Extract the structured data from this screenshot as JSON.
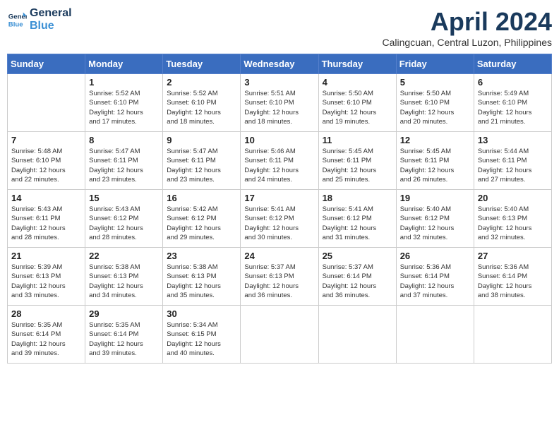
{
  "header": {
    "logo_line1": "General",
    "logo_line2": "Blue",
    "month": "April 2024",
    "location": "Calingcuan, Central Luzon, Philippines"
  },
  "weekdays": [
    "Sunday",
    "Monday",
    "Tuesday",
    "Wednesday",
    "Thursday",
    "Friday",
    "Saturday"
  ],
  "weeks": [
    [
      {
        "day": "",
        "info": ""
      },
      {
        "day": "1",
        "info": "Sunrise: 5:52 AM\nSunset: 6:10 PM\nDaylight: 12 hours\nand 17 minutes."
      },
      {
        "day": "2",
        "info": "Sunrise: 5:52 AM\nSunset: 6:10 PM\nDaylight: 12 hours\nand 18 minutes."
      },
      {
        "day": "3",
        "info": "Sunrise: 5:51 AM\nSunset: 6:10 PM\nDaylight: 12 hours\nand 18 minutes."
      },
      {
        "day": "4",
        "info": "Sunrise: 5:50 AM\nSunset: 6:10 PM\nDaylight: 12 hours\nand 19 minutes."
      },
      {
        "day": "5",
        "info": "Sunrise: 5:50 AM\nSunset: 6:10 PM\nDaylight: 12 hours\nand 20 minutes."
      },
      {
        "day": "6",
        "info": "Sunrise: 5:49 AM\nSunset: 6:10 PM\nDaylight: 12 hours\nand 21 minutes."
      }
    ],
    [
      {
        "day": "7",
        "info": "Sunrise: 5:48 AM\nSunset: 6:10 PM\nDaylight: 12 hours\nand 22 minutes."
      },
      {
        "day": "8",
        "info": "Sunrise: 5:47 AM\nSunset: 6:11 PM\nDaylight: 12 hours\nand 23 minutes."
      },
      {
        "day": "9",
        "info": "Sunrise: 5:47 AM\nSunset: 6:11 PM\nDaylight: 12 hours\nand 23 minutes."
      },
      {
        "day": "10",
        "info": "Sunrise: 5:46 AM\nSunset: 6:11 PM\nDaylight: 12 hours\nand 24 minutes."
      },
      {
        "day": "11",
        "info": "Sunrise: 5:45 AM\nSunset: 6:11 PM\nDaylight: 12 hours\nand 25 minutes."
      },
      {
        "day": "12",
        "info": "Sunrise: 5:45 AM\nSunset: 6:11 PM\nDaylight: 12 hours\nand 26 minutes."
      },
      {
        "day": "13",
        "info": "Sunrise: 5:44 AM\nSunset: 6:11 PM\nDaylight: 12 hours\nand 27 minutes."
      }
    ],
    [
      {
        "day": "14",
        "info": "Sunrise: 5:43 AM\nSunset: 6:11 PM\nDaylight: 12 hours\nand 28 minutes."
      },
      {
        "day": "15",
        "info": "Sunrise: 5:43 AM\nSunset: 6:12 PM\nDaylight: 12 hours\nand 28 minutes."
      },
      {
        "day": "16",
        "info": "Sunrise: 5:42 AM\nSunset: 6:12 PM\nDaylight: 12 hours\nand 29 minutes."
      },
      {
        "day": "17",
        "info": "Sunrise: 5:41 AM\nSunset: 6:12 PM\nDaylight: 12 hours\nand 30 minutes."
      },
      {
        "day": "18",
        "info": "Sunrise: 5:41 AM\nSunset: 6:12 PM\nDaylight: 12 hours\nand 31 minutes."
      },
      {
        "day": "19",
        "info": "Sunrise: 5:40 AM\nSunset: 6:12 PM\nDaylight: 12 hours\nand 32 minutes."
      },
      {
        "day": "20",
        "info": "Sunrise: 5:40 AM\nSunset: 6:13 PM\nDaylight: 12 hours\nand 32 minutes."
      }
    ],
    [
      {
        "day": "21",
        "info": "Sunrise: 5:39 AM\nSunset: 6:13 PM\nDaylight: 12 hours\nand 33 minutes."
      },
      {
        "day": "22",
        "info": "Sunrise: 5:38 AM\nSunset: 6:13 PM\nDaylight: 12 hours\nand 34 minutes."
      },
      {
        "day": "23",
        "info": "Sunrise: 5:38 AM\nSunset: 6:13 PM\nDaylight: 12 hours\nand 35 minutes."
      },
      {
        "day": "24",
        "info": "Sunrise: 5:37 AM\nSunset: 6:13 PM\nDaylight: 12 hours\nand 36 minutes."
      },
      {
        "day": "25",
        "info": "Sunrise: 5:37 AM\nSunset: 6:14 PM\nDaylight: 12 hours\nand 36 minutes."
      },
      {
        "day": "26",
        "info": "Sunrise: 5:36 AM\nSunset: 6:14 PM\nDaylight: 12 hours\nand 37 minutes."
      },
      {
        "day": "27",
        "info": "Sunrise: 5:36 AM\nSunset: 6:14 PM\nDaylight: 12 hours\nand 38 minutes."
      }
    ],
    [
      {
        "day": "28",
        "info": "Sunrise: 5:35 AM\nSunset: 6:14 PM\nDaylight: 12 hours\nand 39 minutes."
      },
      {
        "day": "29",
        "info": "Sunrise: 5:35 AM\nSunset: 6:14 PM\nDaylight: 12 hours\nand 39 minutes."
      },
      {
        "day": "30",
        "info": "Sunrise: 5:34 AM\nSunset: 6:15 PM\nDaylight: 12 hours\nand 40 minutes."
      },
      {
        "day": "",
        "info": ""
      },
      {
        "day": "",
        "info": ""
      },
      {
        "day": "",
        "info": ""
      },
      {
        "day": "",
        "info": ""
      }
    ]
  ]
}
